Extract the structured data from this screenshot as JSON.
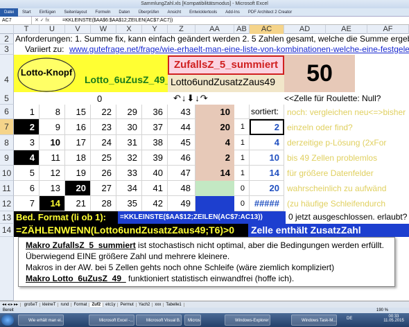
{
  "window_title": "SammlungZahl.xls [Kompatibilitätsmodus] - Microsoft Excel",
  "ribbon_tabs": [
    "Datei",
    "Start",
    "Einfügen",
    "Seitenlayout",
    "Formeln",
    "Daten",
    "Überprüfen",
    "Ansicht",
    "Entwicklertools",
    "Add-Ins",
    "PDF Architect 2 Creator"
  ],
  "namebox": "AC7",
  "formula": "=KKLEINSTE($AA$6:$AA$12;ZEILEN(AC$7:AC7))",
  "columns": [
    "T",
    "U",
    "V",
    "W",
    "X",
    "Y",
    "Z",
    "AA",
    "AB",
    "AC",
    "AD",
    "AE",
    "AF"
  ],
  "row2": "Anforderungen: 1. Summe fix, kann einfach geändert werden 2. 5 Zahlen gesamt, welche die Summe ergeb",
  "row3_label": "Variiert zu:",
  "row3_link": "www.gutefrage.net/frage/wie-erhaelt-man-eine-liste-von-kombinationen-welche-eine-festgeled",
  "lotto_button": "Lotto-Knopf",
  "lotto_macro": "Lotto_6uZusZ_49_",
  "zufall_button": "ZufallsZ_5_summiert",
  "lotto_zusatz": "Lotto6undZusatzZaus49",
  "big_number": "50",
  "row5_zero": "0",
  "roulette": "<<Zelle für Roulette: Null?",
  "grid": [
    [
      "1",
      "8",
      "15",
      "22",
      "29",
      "36",
      "43",
      "10",
      "",
      ""
    ],
    [
      "2",
      "9",
      "16",
      "23",
      "30",
      "37",
      "44",
      "20",
      "1",
      "2"
    ],
    [
      "3",
      "10",
      "17",
      "24",
      "31",
      "38",
      "45",
      "4",
      "1",
      "4"
    ],
    [
      "4",
      "11",
      "18",
      "25",
      "32",
      "39",
      "46",
      "2",
      "1",
      "10"
    ],
    [
      "5",
      "12",
      "19",
      "26",
      "33",
      "40",
      "47",
      "14",
      "1",
      "14"
    ],
    [
      "6",
      "13",
      "20",
      "27",
      "34",
      "41",
      "48",
      "",
      "0",
      "20"
    ],
    [
      "7",
      "14",
      "21",
      "28",
      "35",
      "42",
      "49",
      "",
      "0",
      "#####"
    ]
  ],
  "sortiert": "sortiert:",
  "notes": [
    "noch: vergleichen neu<=>bisher",
    "einzeln oder find?",
    "derzeitige p-Lösung (2xFor",
    "bis 49 Zellen problemlos",
    "für größere Datenfelder",
    "wahrscheinlich zu aufwänd",
    "(zu häufige Schleifendurch"
  ],
  "row13_label": "Bed. Format (li ob 1):",
  "row13_formula": "=KKLEINSTE($AA$12;ZEILEN(AC$7:AC13))",
  "row13_note": "0 jetzt ausgeschlossen. erlaubt?",
  "row14_formula": "=ZÄHLENWENN(Lotto6undZusatzZaus49;T6)>0",
  "row14_note": "Zelle enthält ZusatzZahl",
  "textbox": [
    "Makro ZufallsZ_5_summiert ist stochastisch nicht optimal, aber die Bedingungen werden erfüllt.",
    "Überwiegend EINE größere Zahl und mehrere kleinere.",
    "Makros in der AW. bei 5 Zellen gehts noch ohne Schleife (wäre ziemlich kompliziert)",
    "Makro Lotto_6uZusZ_49_ funktioniert statistisch einwandfrei (hoffe ich)."
  ],
  "textbox_bold": [
    "Makro ZufallsZ_5_summiert",
    "Makro Lotto_6uZusZ_49_"
  ],
  "sheet_tabs": [
    "großeT",
    "kleineT",
    "rund",
    "Format",
    "Zuf2",
    "etc1y",
    "Permut",
    "Yach2",
    "xxx",
    "Tabelle1"
  ],
  "status": "Bereit",
  "zoom": "190 %",
  "taskbar": [
    "Wie erhält man ei...",
    "Microsoft Excel -...",
    "Microsoft Visual B...",
    "Windows-Explorer",
    "Windows Task-M...",
    "Microsoft Paint"
  ],
  "clock_time": "00:33",
  "clock_date": "11.05.2015",
  "lang": "DE"
}
